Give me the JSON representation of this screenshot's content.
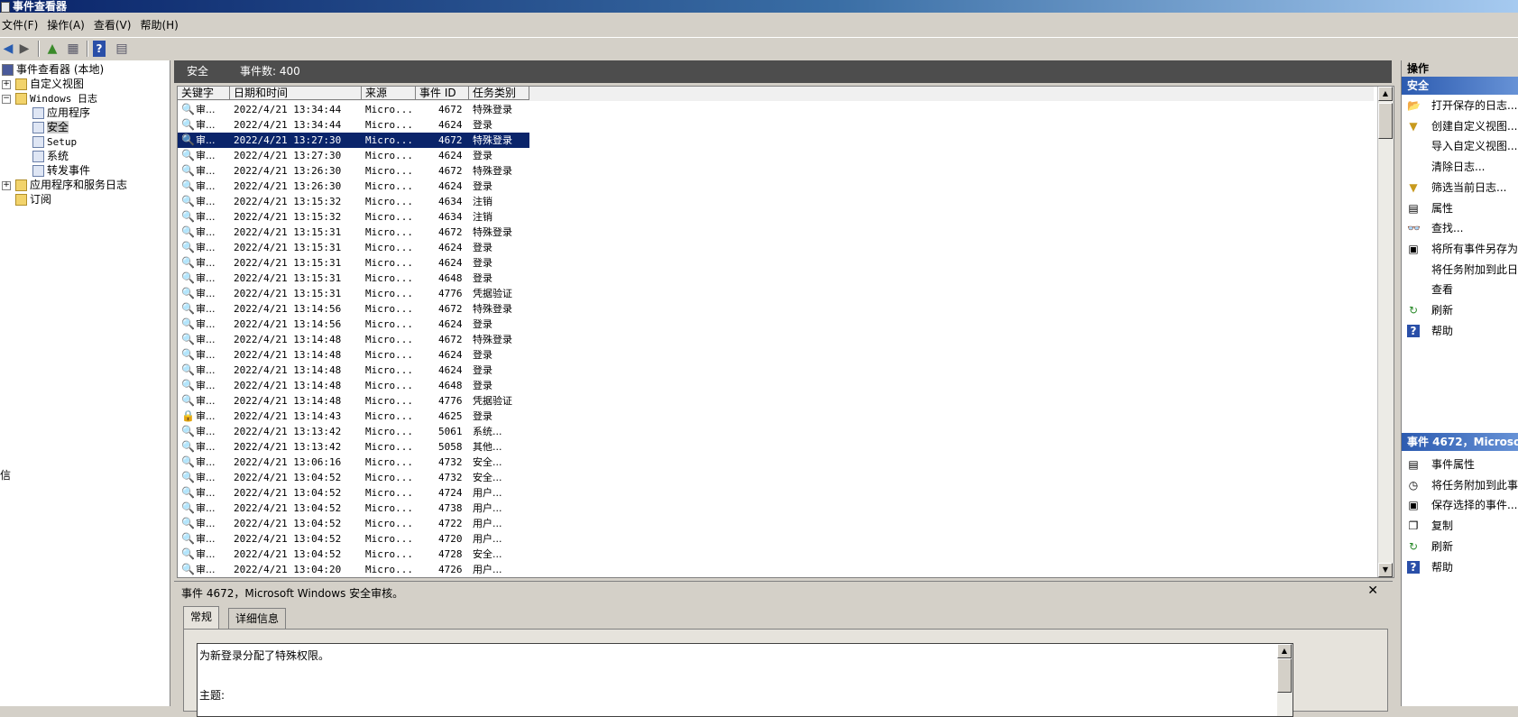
{
  "window": {
    "title": "事件查看器"
  },
  "menu": [
    "文件(F)",
    "操作(A)",
    "查看(V)",
    "帮助(H)"
  ],
  "tree": {
    "items": [
      {
        "label": "事件查看器 (本地)",
        "icon": "event-viewer-icon"
      },
      {
        "label": "自定义视图",
        "icon": "folder-icon"
      },
      {
        "label": "Windows 日志",
        "icon": "windows-logs-icon"
      },
      {
        "label": "应用程序",
        "icon": "log-icon"
      },
      {
        "label": "安全",
        "icon": "log-icon"
      },
      {
        "label": "Setup",
        "icon": "log-icon"
      },
      {
        "label": "系统",
        "icon": "log-icon"
      },
      {
        "label": "转发事件",
        "icon": "log-icon"
      },
      {
        "label": "应用程序和服务日志",
        "icon": "folder-icon"
      },
      {
        "label": "订阅",
        "icon": "subscription-icon"
      }
    ]
  },
  "center": {
    "log_name": "安全",
    "event_count": "事件数: 400"
  },
  "grid": {
    "columns": [
      "关键字",
      "日期和时间",
      "来源",
      "事件 ID",
      "任务类别"
    ],
    "rows": [
      {
        "keyword": "审...",
        "datetime": "2022/4/21 13:34:44",
        "source": "Micro...",
        "id": "4672",
        "category": "特殊登录"
      },
      {
        "keyword": "审...",
        "datetime": "2022/4/21 13:34:44",
        "source": "Micro...",
        "id": "4624",
        "category": "登录"
      },
      {
        "keyword": "审...",
        "datetime": "2022/4/21 13:27:30",
        "source": "Micro...",
        "id": "4672",
        "category": "特殊登录"
      },
      {
        "keyword": "审...",
        "datetime": "2022/4/21 13:27:30",
        "source": "Micro...",
        "id": "4624",
        "category": "登录"
      },
      {
        "keyword": "审...",
        "datetime": "2022/4/21 13:26:30",
        "source": "Micro...",
        "id": "4672",
        "category": "特殊登录"
      },
      {
        "keyword": "审...",
        "datetime": "2022/4/21 13:26:30",
        "source": "Micro...",
        "id": "4624",
        "category": "登录"
      },
      {
        "keyword": "审...",
        "datetime": "2022/4/21 13:15:32",
        "source": "Micro...",
        "id": "4634",
        "category": "注销"
      },
      {
        "keyword": "审...",
        "datetime": "2022/4/21 13:15:32",
        "source": "Micro...",
        "id": "4634",
        "category": "注销"
      },
      {
        "keyword": "审...",
        "datetime": "2022/4/21 13:15:31",
        "source": "Micro...",
        "id": "4672",
        "category": "特殊登录"
      },
      {
        "keyword": "审...",
        "datetime": "2022/4/21 13:15:31",
        "source": "Micro...",
        "id": "4624",
        "category": "登录"
      },
      {
        "keyword": "审...",
        "datetime": "2022/4/21 13:15:31",
        "source": "Micro...",
        "id": "4624",
        "category": "登录"
      },
      {
        "keyword": "审...",
        "datetime": "2022/4/21 13:15:31",
        "source": "Micro...",
        "id": "4648",
        "category": "登录"
      },
      {
        "keyword": "审...",
        "datetime": "2022/4/21 13:15:31",
        "source": "Micro...",
        "id": "4776",
        "category": "凭据验证"
      },
      {
        "keyword": "审...",
        "datetime": "2022/4/21 13:14:56",
        "source": "Micro...",
        "id": "4672",
        "category": "特殊登录"
      },
      {
        "keyword": "审...",
        "datetime": "2022/4/21 13:14:56",
        "source": "Micro...",
        "id": "4624",
        "category": "登录"
      },
      {
        "keyword": "审...",
        "datetime": "2022/4/21 13:14:48",
        "source": "Micro...",
        "id": "4672",
        "category": "特殊登录"
      },
      {
        "keyword": "审...",
        "datetime": "2022/4/21 13:14:48",
        "source": "Micro...",
        "id": "4624",
        "category": "登录"
      },
      {
        "keyword": "审...",
        "datetime": "2022/4/21 13:14:48",
        "source": "Micro...",
        "id": "4624",
        "category": "登录"
      },
      {
        "keyword": "审...",
        "datetime": "2022/4/21 13:14:48",
        "source": "Micro...",
        "id": "4648",
        "category": "登录"
      },
      {
        "keyword": "审...",
        "datetime": "2022/4/21 13:14:48",
        "source": "Micro...",
        "id": "4776",
        "category": "凭据验证"
      },
      {
        "keyword": "审...",
        "datetime": "2022/4/21 13:14:43",
        "source": "Micro...",
        "id": "4625",
        "category": "登录"
      },
      {
        "keyword": "审...",
        "datetime": "2022/4/21 13:13:42",
        "source": "Micro...",
        "id": "5061",
        "category": "系统..."
      },
      {
        "keyword": "审...",
        "datetime": "2022/4/21 13:13:42",
        "source": "Micro...",
        "id": "5058",
        "category": "其他..."
      },
      {
        "keyword": "审...",
        "datetime": "2022/4/21 13:06:16",
        "source": "Micro...",
        "id": "4732",
        "category": "安全..."
      },
      {
        "keyword": "审...",
        "datetime": "2022/4/21 13:04:52",
        "source": "Micro...",
        "id": "4732",
        "category": "安全..."
      },
      {
        "keyword": "审...",
        "datetime": "2022/4/21 13:04:52",
        "source": "Micro...",
        "id": "4724",
        "category": "用户..."
      },
      {
        "keyword": "审...",
        "datetime": "2022/4/21 13:04:52",
        "source": "Micro...",
        "id": "4738",
        "category": "用户..."
      },
      {
        "keyword": "审...",
        "datetime": "2022/4/21 13:04:52",
        "source": "Micro...",
        "id": "4722",
        "category": "用户..."
      },
      {
        "keyword": "审...",
        "datetime": "2022/4/21 13:04:52",
        "source": "Micro...",
        "id": "4720",
        "category": "用户..."
      },
      {
        "keyword": "审...",
        "datetime": "2022/4/21 13:04:52",
        "source": "Micro...",
        "id": "4728",
        "category": "安全..."
      },
      {
        "keyword": "审...",
        "datetime": "2022/4/21 13:04:20",
        "source": "Micro...",
        "id": "4726",
        "category": "用户..."
      }
    ],
    "selected_index": 2
  },
  "detail": {
    "title": "事件 4672，Microsoft Windows 安全审核。",
    "tabs": [
      "常规",
      "详细信息"
    ],
    "description": "为新登录分配了特殊权限。",
    "subject_label": "主题:"
  },
  "actions": {
    "header": "操作",
    "section1_title": "安全",
    "section1_items": [
      {
        "label": "打开保存的日志...",
        "icon": "folder-open-icon"
      },
      {
        "label": "创建自定义视图...",
        "icon": "filter-icon"
      },
      {
        "label": "导入自定义视图...",
        "icon": ""
      },
      {
        "label": "清除日志...",
        "icon": ""
      },
      {
        "label": "筛选当前日志...",
        "icon": "filter-icon"
      },
      {
        "label": "属性",
        "icon": "properties-icon"
      },
      {
        "label": "查找...",
        "icon": "binoculars-icon"
      },
      {
        "label": "将所有事件另存为",
        "icon": "save-icon"
      },
      {
        "label": "将任务附加到此日",
        "icon": ""
      },
      {
        "label": "查看",
        "icon": ""
      },
      {
        "label": "刷新",
        "icon": "refresh-icon"
      },
      {
        "label": "帮助",
        "icon": "help-icon"
      }
    ],
    "section2_title": "事件 4672，Microso",
    "section2_items": [
      {
        "label": "事件属性",
        "icon": "properties-icon"
      },
      {
        "label": "将任务附加到此事",
        "icon": "task-icon"
      },
      {
        "label": "保存选择的事件...",
        "icon": "save-icon"
      },
      {
        "label": "复制",
        "icon": "copy-icon"
      },
      {
        "label": "刷新",
        "icon": "refresh-icon"
      },
      {
        "label": "帮助",
        "icon": "help-icon"
      }
    ]
  },
  "stray_text": "信"
}
